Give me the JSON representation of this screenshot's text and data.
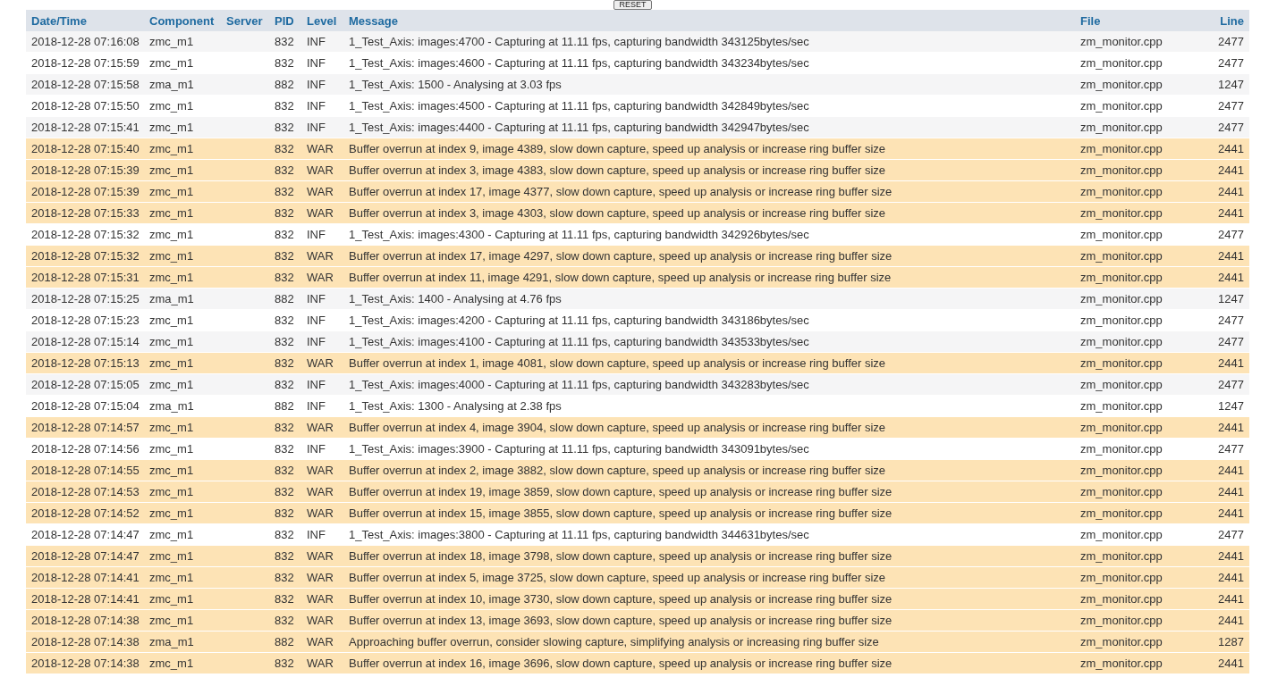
{
  "reset_button": "RESET",
  "table": {
    "columns": [
      "Date/Time",
      "Component",
      "Server",
      "PID",
      "Level",
      "Message",
      "File",
      "Line"
    ],
    "rows": [
      {
        "kind": "info",
        "datetime": "2018-12-28 07:16:08",
        "component": "zmc_m1",
        "pid": "832",
        "severity": "INF",
        "message": "1_Test_Axis: images:4700 - Capturing at 11.11 fps, capturing bandwidth 343125bytes/sec",
        "file": "zm_monitor.cpp",
        "line": "2477"
      },
      {
        "kind": "info",
        "datetime": "2018-12-28 07:15:59",
        "component": "zmc_m1",
        "pid": "832",
        "severity": "INF",
        "message": "1_Test_Axis: images:4600 - Capturing at 11.11 fps, capturing bandwidth 343234bytes/sec",
        "file": "zm_monitor.cpp",
        "line": "2477"
      },
      {
        "kind": "info",
        "datetime": "2018-12-28 07:15:58",
        "component": "zma_m1",
        "pid": "882",
        "severity": "INF",
        "message": "1_Test_Axis: 1500 - Analysing at 3.03 fps",
        "file": "zm_monitor.cpp",
        "line": "1247"
      },
      {
        "kind": "info",
        "datetime": "2018-12-28 07:15:50",
        "component": "zmc_m1",
        "pid": "832",
        "severity": "INF",
        "message": "1_Test_Axis: images:4500 - Capturing at 11.11 fps, capturing bandwidth 342849bytes/sec",
        "file": "zm_monitor.cpp",
        "line": "2477"
      },
      {
        "kind": "info",
        "datetime": "2018-12-28 07:15:41",
        "component": "zmc_m1",
        "pid": "832",
        "severity": "INF",
        "message": "1_Test_Axis: images:4400 - Capturing at 11.11 fps, capturing bandwidth 342947bytes/sec",
        "file": "zm_monitor.cpp",
        "line": "2477"
      },
      {
        "kind": "warning",
        "datetime": "2018-12-28 07:15:40",
        "component": "zmc_m1",
        "pid": "832",
        "severity": "WAR",
        "message": "Buffer overrun at index 9, image 4389, slow down capture, speed up analysis or increase ring buffer size",
        "file": "zm_monitor.cpp",
        "line": "2441"
      },
      {
        "kind": "warning",
        "datetime": "2018-12-28 07:15:39",
        "component": "zmc_m1",
        "pid": "832",
        "severity": "WAR",
        "message": "Buffer overrun at index 3, image 4383, slow down capture, speed up analysis or increase ring buffer size",
        "file": "zm_monitor.cpp",
        "line": "2441"
      },
      {
        "kind": "warning",
        "datetime": "2018-12-28 07:15:39",
        "component": "zmc_m1",
        "pid": "832",
        "severity": "WAR",
        "message": "Buffer overrun at index 17, image 4377, slow down capture, speed up analysis or increase ring buffer size",
        "file": "zm_monitor.cpp",
        "line": "2441"
      },
      {
        "kind": "warning",
        "datetime": "2018-12-28 07:15:33",
        "component": "zmc_m1",
        "pid": "832",
        "severity": "WAR",
        "message": "Buffer overrun at index 3, image 4303, slow down capture, speed up analysis or increase ring buffer size",
        "file": "zm_monitor.cpp",
        "line": "2441"
      },
      {
        "kind": "info",
        "datetime": "2018-12-28 07:15:32",
        "component": "zmc_m1",
        "pid": "832",
        "severity": "INF",
        "message": "1_Test_Axis: images:4300 - Capturing at 11.11 fps, capturing bandwidth 342926bytes/sec",
        "file": "zm_monitor.cpp",
        "line": "2477"
      },
      {
        "kind": "warning",
        "datetime": "2018-12-28 07:15:32",
        "component": "zmc_m1",
        "pid": "832",
        "severity": "WAR",
        "message": "Buffer overrun at index 17, image 4297, slow down capture, speed up analysis or increase ring buffer size",
        "file": "zm_monitor.cpp",
        "line": "2441"
      },
      {
        "kind": "warning",
        "datetime": "2018-12-28 07:15:31",
        "component": "zmc_m1",
        "pid": "832",
        "severity": "WAR",
        "message": "Buffer overrun at index 11, image 4291, slow down capture, speed up analysis or increase ring buffer size",
        "file": "zm_monitor.cpp",
        "line": "2441"
      },
      {
        "kind": "info",
        "datetime": "2018-12-28 07:15:25",
        "component": "zma_m1",
        "pid": "882",
        "severity": "INF",
        "message": "1_Test_Axis: 1400 - Analysing at 4.76 fps",
        "file": "zm_monitor.cpp",
        "line": "1247"
      },
      {
        "kind": "info",
        "datetime": "2018-12-28 07:15:23",
        "component": "zmc_m1",
        "pid": "832",
        "severity": "INF",
        "message": "1_Test_Axis: images:4200 - Capturing at 11.11 fps, capturing bandwidth 343186bytes/sec",
        "file": "zm_monitor.cpp",
        "line": "2477"
      },
      {
        "kind": "info",
        "datetime": "2018-12-28 07:15:14",
        "component": "zmc_m1",
        "pid": "832",
        "severity": "INF",
        "message": "1_Test_Axis: images:4100 - Capturing at 11.11 fps, capturing bandwidth 343533bytes/sec",
        "file": "zm_monitor.cpp",
        "line": "2477"
      },
      {
        "kind": "warning",
        "datetime": "2018-12-28 07:15:13",
        "component": "zmc_m1",
        "pid": "832",
        "severity": "WAR",
        "message": "Buffer overrun at index 1, image 4081, slow down capture, speed up analysis or increase ring buffer size",
        "file": "zm_monitor.cpp",
        "line": "2441"
      },
      {
        "kind": "info",
        "datetime": "2018-12-28 07:15:05",
        "component": "zmc_m1",
        "pid": "832",
        "severity": "INF",
        "message": "1_Test_Axis: images:4000 - Capturing at 11.11 fps, capturing bandwidth 343283bytes/sec",
        "file": "zm_monitor.cpp",
        "line": "2477"
      },
      {
        "kind": "info",
        "datetime": "2018-12-28 07:15:04",
        "component": "zma_m1",
        "pid": "882",
        "severity": "INF",
        "message": "1_Test_Axis: 1300 - Analysing at 2.38 fps",
        "file": "zm_monitor.cpp",
        "line": "1247"
      },
      {
        "kind": "warning",
        "datetime": "2018-12-28 07:14:57",
        "component": "zmc_m1",
        "pid": "832",
        "severity": "WAR",
        "message": "Buffer overrun at index 4, image 3904, slow down capture, speed up analysis or increase ring buffer size",
        "file": "zm_monitor.cpp",
        "line": "2441"
      },
      {
        "kind": "info",
        "datetime": "2018-12-28 07:14:56",
        "component": "zmc_m1",
        "pid": "832",
        "severity": "INF",
        "message": "1_Test_Axis: images:3900 - Capturing at 11.11 fps, capturing bandwidth 343091bytes/sec",
        "file": "zm_monitor.cpp",
        "line": "2477"
      },
      {
        "kind": "warning",
        "datetime": "2018-12-28 07:14:55",
        "component": "zmc_m1",
        "pid": "832",
        "severity": "WAR",
        "message": "Buffer overrun at index 2, image 3882, slow down capture, speed up analysis or increase ring buffer size",
        "file": "zm_monitor.cpp",
        "line": "2441"
      },
      {
        "kind": "warning",
        "datetime": "2018-12-28 07:14:53",
        "component": "zmc_m1",
        "pid": "832",
        "severity": "WAR",
        "message": "Buffer overrun at index 19, image 3859, slow down capture, speed up analysis or increase ring buffer size",
        "file": "zm_monitor.cpp",
        "line": "2441"
      },
      {
        "kind": "warning",
        "datetime": "2018-12-28 07:14:52",
        "component": "zmc_m1",
        "pid": "832",
        "severity": "WAR",
        "message": "Buffer overrun at index 15, image 3855, slow down capture, speed up analysis or increase ring buffer size",
        "file": "zm_monitor.cpp",
        "line": "2441"
      },
      {
        "kind": "info",
        "datetime": "2018-12-28 07:14:47",
        "component": "zmc_m1",
        "pid": "832",
        "severity": "INF",
        "message": "1_Test_Axis: images:3800 - Capturing at 11.11 fps, capturing bandwidth 344631bytes/sec",
        "file": "zm_monitor.cpp",
        "line": "2477"
      },
      {
        "kind": "warning",
        "datetime": "2018-12-28 07:14:47",
        "component": "zmc_m1",
        "pid": "832",
        "severity": "WAR",
        "message": "Buffer overrun at index 18, image 3798, slow down capture, speed up analysis or increase ring buffer size",
        "file": "zm_monitor.cpp",
        "line": "2441"
      },
      {
        "kind": "warning",
        "datetime": "2018-12-28 07:14:41",
        "component": "zmc_m1",
        "pid": "832",
        "severity": "WAR",
        "message": "Buffer overrun at index 5, image 3725, slow down capture, speed up analysis or increase ring buffer size",
        "file": "zm_monitor.cpp",
        "line": "2441"
      },
      {
        "kind": "warning",
        "datetime": "2018-12-28 07:14:41",
        "component": "zmc_m1",
        "pid": "832",
        "severity": "WAR",
        "message": "Buffer overrun at index 10, image 3730, slow down capture, speed up analysis or increase ring buffer size",
        "file": "zm_monitor.cpp",
        "line": "2441"
      },
      {
        "kind": "warning",
        "datetime": "2018-12-28 07:14:38",
        "component": "zmc_m1",
        "pid": "832",
        "severity": "WAR",
        "message": "Buffer overrun at index 13, image 3693, slow down capture, speed up analysis or increase ring buffer size",
        "file": "zm_monitor.cpp",
        "line": "2441"
      },
      {
        "kind": "warning",
        "datetime": "2018-12-28 07:14:38",
        "component": "zma_m1",
        "pid": "882",
        "severity": "WAR",
        "message": "Approaching buffer overrun, consider slowing capture, simplifying analysis or increasing ring buffer size",
        "file": "zm_monitor.cpp",
        "line": "1287"
      },
      {
        "kind": "warning",
        "datetime": "2018-12-28 07:14:38",
        "component": "zmc_m1",
        "pid": "832",
        "severity": "WAR",
        "message": "Buffer overrun at index 16, image 3696, slow down capture, speed up analysis or increase ring buffer size",
        "file": "zm_monitor.cpp",
        "line": "2441"
      }
    ]
  }
}
